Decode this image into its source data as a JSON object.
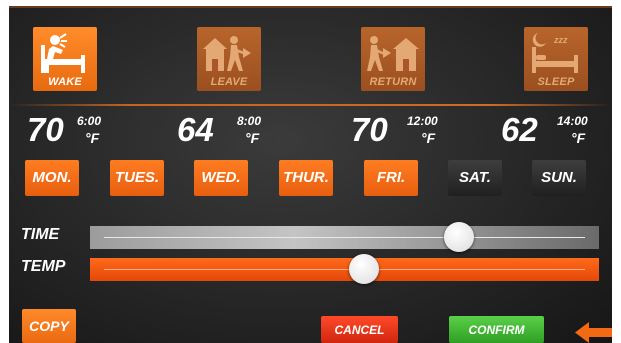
{
  "modes": [
    {
      "label": "WAKE",
      "icon": "wake-person-bed-icon",
      "active": true
    },
    {
      "label": "LEAVE",
      "icon": "person-leaving-house-icon",
      "active": false
    },
    {
      "label": "RETURN",
      "icon": "person-returning-house-icon",
      "active": false
    },
    {
      "label": "SLEEP",
      "icon": "sleeping-bed-zzz-icon",
      "active": false
    }
  ],
  "temperatures": [
    {
      "value": "70",
      "time": "6:00",
      "unit": "°F"
    },
    {
      "value": "64",
      "time": "8:00",
      "unit": "°F"
    },
    {
      "value": "70",
      "time": "12:00",
      "unit": "°F"
    },
    {
      "value": "62",
      "time": "14:00",
      "unit": "°F"
    }
  ],
  "days": [
    {
      "label": "MON.",
      "selected": true
    },
    {
      "label": "TUES.",
      "selected": true
    },
    {
      "label": "WED.",
      "selected": true
    },
    {
      "label": "THUR.",
      "selected": true
    },
    {
      "label": "FRI.",
      "selected": true
    },
    {
      "label": "SAT.",
      "selected": false
    },
    {
      "label": "SUN.",
      "selected": false
    }
  ],
  "sliders": {
    "time": {
      "label": "TIME",
      "position_fraction": 0.74
    },
    "temp": {
      "label": "TEMP",
      "position_fraction": 0.54
    }
  },
  "buttons": {
    "copy": "COPY",
    "cancel": "CANCEL",
    "confirm": "CONFIRM"
  },
  "colors": {
    "accent_orange": "#f26a14",
    "cancel_red": "#e2351d",
    "confirm_green": "#45b836",
    "background": "#2a2a2a"
  }
}
